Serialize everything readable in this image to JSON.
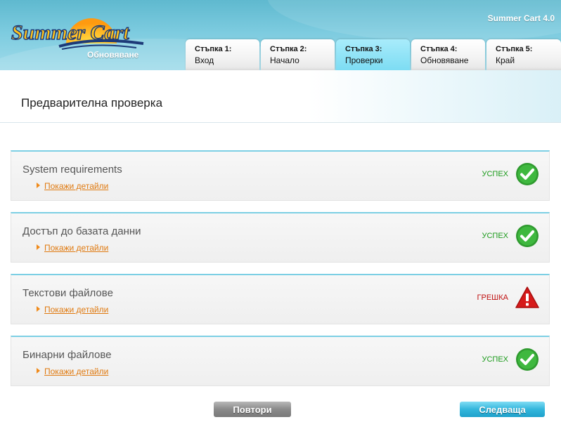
{
  "header": {
    "app_title": "Summer Cart 4.0",
    "logo_text": "Summer Cart",
    "logo_subtitle": "Обновяване"
  },
  "tabs": [
    {
      "step": "Стъпка 1:",
      "label": "Вход",
      "active": false
    },
    {
      "step": "Стъпка 2:",
      "label": "Начало",
      "active": false
    },
    {
      "step": "Стъпка 3:",
      "label": "Проверки",
      "active": true
    },
    {
      "step": "Стъпка 4:",
      "label": "Обновяване",
      "active": false
    },
    {
      "step": "Стъпка 5:",
      "label": "Край",
      "active": false
    }
  ],
  "page": {
    "title": "Предварителна проверка"
  },
  "checks": [
    {
      "name": "System requirements",
      "details_link": "Покажи детайли",
      "status": "УСПЕХ",
      "state": "success"
    },
    {
      "name": "Достъп до базата данни",
      "details_link": "Покажи детайли",
      "status": "УСПЕХ",
      "state": "success"
    },
    {
      "name": "Текстови файлове",
      "details_link": "Покажи детайли",
      "status": "ГРЕШКА",
      "state": "error"
    },
    {
      "name": "Бинарни файлове",
      "details_link": "Покажи детайли",
      "status": "УСПЕХ",
      "state": "success"
    }
  ],
  "buttons": {
    "retry": "Повтори",
    "next": "Следваща"
  },
  "colors": {
    "accent": "#7ccfe4",
    "success": "#1a9a1a",
    "error": "#c01010",
    "link": "#e07a10"
  }
}
